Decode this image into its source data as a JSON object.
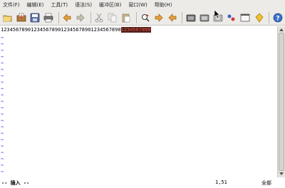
{
  "menu": [
    "文件(F)",
    "编辑(E)",
    "工具(T)",
    "语法(S)",
    "缓冲区(B)",
    "窗口(W)",
    "帮助(H)"
  ],
  "toolbar_icons": [
    "open-icon",
    "save-icon",
    "save-all-icon",
    "print-icon",
    "undo-icon",
    "redo-icon",
    "cut-icon",
    "copy-icon",
    "paste-icon",
    "find-replace-icon",
    "find-next-icon",
    "find-prev-icon",
    "load-session-icon",
    "save-session-icon",
    "run-script-icon",
    "make-icon",
    "shell-icon",
    "tags-icon",
    "help-icon"
  ],
  "editor": {
    "line1_plain": "1234567890123456789012345678901234567890",
    "line1_selected": "1234567890",
    "tilde": "~",
    "tilde_count": 23
  },
  "status": {
    "mode": "-- 插入 --",
    "position": "1,51",
    "scope": "全部"
  },
  "colors": {
    "selection_bg": "#4a1f14",
    "selection_fg": "#e05050",
    "tilde": "#3b3bd9",
    "chrome": "#ecebe8"
  }
}
